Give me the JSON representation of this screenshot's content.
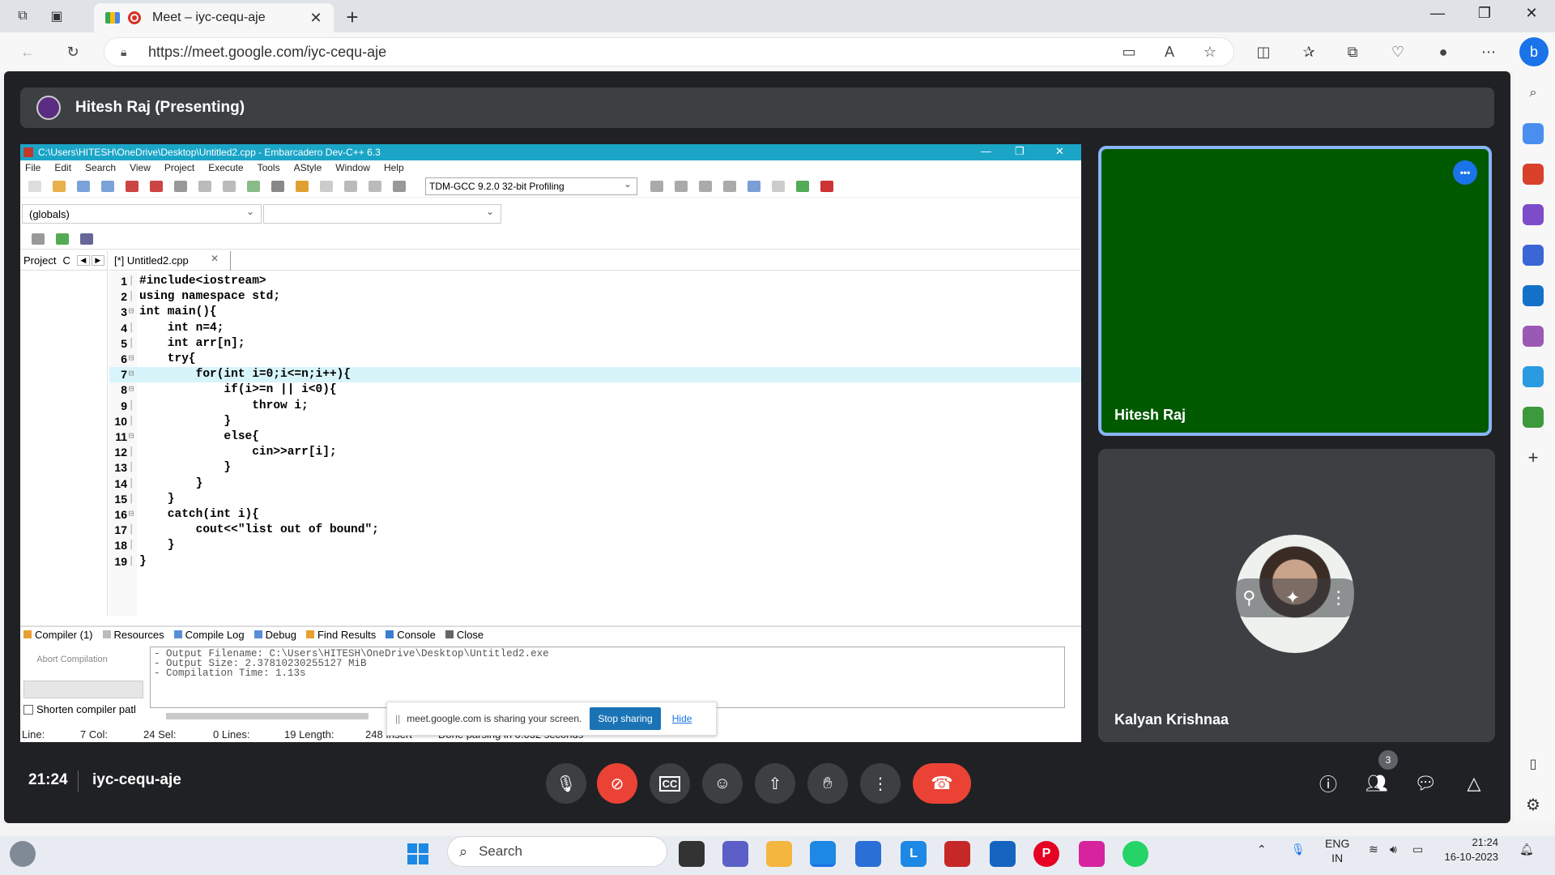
{
  "browser": {
    "tab_title": "Meet – iyc-cequ-aje",
    "url": "https://meet.google.com/iyc-cequ-aje"
  },
  "meet": {
    "presenting_banner": "Hitesh Raj (Presenting)",
    "time": "21:24",
    "meeting_code": "iyc-cequ-aje",
    "participants_count": "3",
    "tiles": [
      {
        "name": "Hitesh Raj"
      },
      {
        "name": "Kalyan Krishnaa"
      }
    ]
  },
  "ide": {
    "title": "C:\\Users\\HITESH\\OneDrive\\Desktop\\Untitled2.cpp - Embarcadero Dev-C++ 6.3",
    "menu": [
      "File",
      "Edit",
      "Search",
      "View",
      "Project",
      "Execute",
      "Tools",
      "AStyle",
      "Window",
      "Help"
    ],
    "compiler": "TDM-GCC 9.2.0 32-bit Profiling",
    "scope_combo": "(globals)",
    "left_tab_project": "Project",
    "left_tab_classes": "C",
    "file_tab": "[*] Untitled2.cpp",
    "code_lines": [
      "#include<iostream>",
      "using namespace std;",
      "int main(){",
      "    int n=4;",
      "    int arr[n];",
      "    try{",
      "        for(int i=0;i<=n;i++){",
      "            if(i>=n || i<0){",
      "                throw i;",
      "            }",
      "            else{",
      "                cin>>arr[i];",
      "            }",
      "        }",
      "    }",
      "    catch(int i){",
      "        cout<<\"list out of bound\";",
      "    }",
      "}"
    ],
    "bottom_tabs": [
      "Compiler (1)",
      "Resources",
      "Compile Log",
      "Debug",
      "Find Results",
      "Console",
      "Close"
    ],
    "abort_label": "Abort Compilation",
    "shorten_label": "Shorten compiler patl",
    "log_lines": [
      "- Output Filename: C:\\Users\\HITESH\\OneDrive\\Desktop\\Untitled2.exe",
      "- Output Size: 2.37810230255127 MiB",
      "- Compilation Time: 1.13s"
    ],
    "status": {
      "line_label": "Line:",
      "line_val": "7 Col:",
      "col_val": "24 Sel:",
      "sel_val": "0 Lines:",
      "lines_val": "19 Length:",
      "insert": "248 Insert",
      "parse": "Done parsing in 0.032 seconds"
    }
  },
  "share_notice": {
    "message": "meet.google.com is sharing your screen.",
    "stop_label": "Stop sharing",
    "hide_label": "Hide"
  },
  "taskbar": {
    "search_label": "Search",
    "lang_line1": "ENG",
    "lang_line2": "IN",
    "clock_time": "21:24",
    "clock_date": "16-10-2023"
  }
}
